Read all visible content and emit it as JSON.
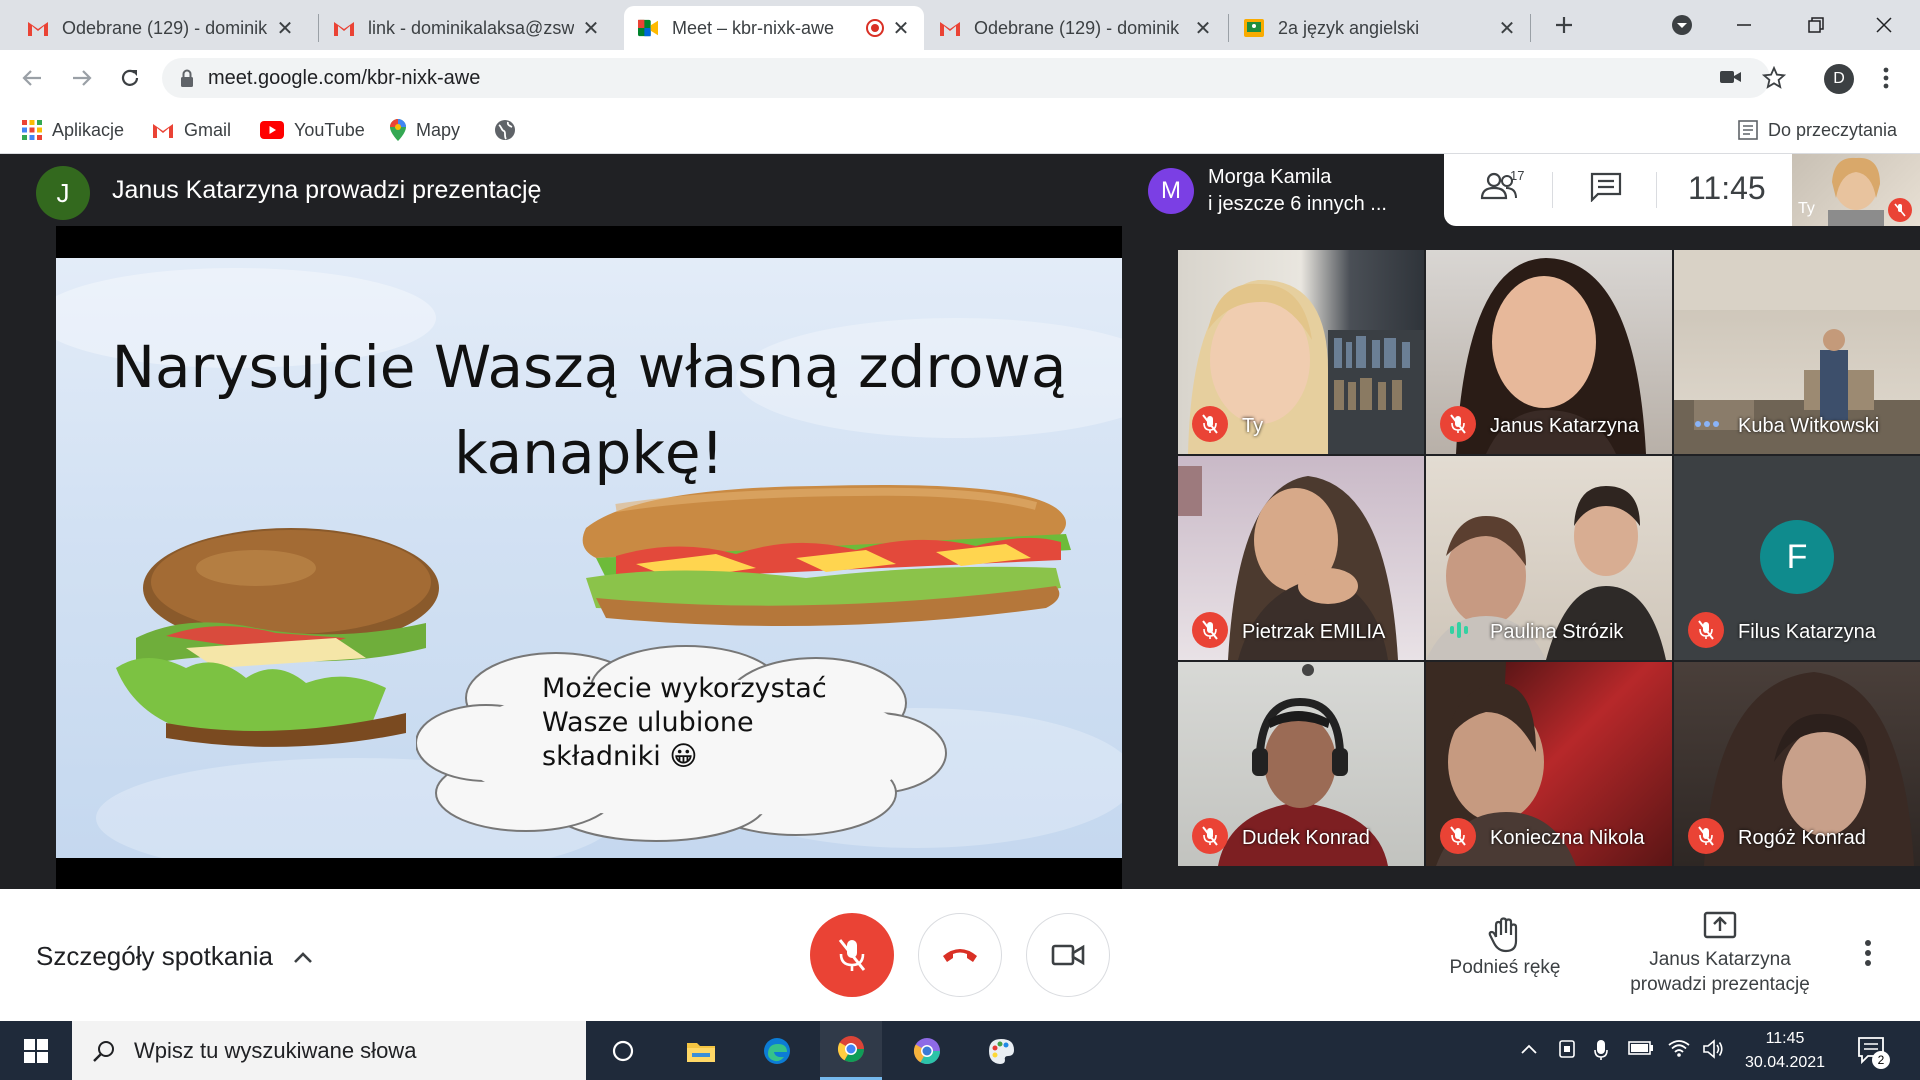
{
  "browser": {
    "tabs": [
      {
        "title": "Odebrane (129) - dominik",
        "icon": "gmail-icon"
      },
      {
        "title": "link - dominikalaksa@zsw",
        "icon": "gmail-icon"
      },
      {
        "title": "Meet – kbr-nixk-awe",
        "icon": "meet-icon",
        "active": true
      },
      {
        "title": "Odebrane (129) - dominik",
        "icon": "gmail-icon"
      },
      {
        "title": "2a język angielski",
        "icon": "classroom-icon"
      }
    ],
    "url": "meet.google.com/kbr-nixk-awe",
    "profile_initial": "D",
    "bookmarks": [
      {
        "label": "Aplikacje",
        "icon": "apps-grid-icon"
      },
      {
        "label": "Gmail",
        "icon": "gmail-icon"
      },
      {
        "label": "YouTube",
        "icon": "youtube-icon"
      },
      {
        "label": "Mapy",
        "icon": "maps-pin-icon"
      },
      {
        "label": "",
        "icon": "globe-icon"
      }
    ],
    "reading_list": "Do przeczytania"
  },
  "meet": {
    "presenter_initial": "J",
    "presenter_text": "Janus Katarzyna prowadzi prezentację",
    "slide": {
      "title_line1": "Narysujcie Waszą własną zdrową",
      "title_line2": "kanapkę!",
      "cloud_line1": "Możecie wykorzystać",
      "cloud_line2": "Wasze ulubione",
      "cloud_line3": "składniki 😀"
    },
    "pinned": {
      "initial": "M",
      "line1": "Morga Kamila",
      "line2": "i jeszcze 6 innych ..."
    },
    "people_count": "17",
    "clock": "11:45",
    "self_label": "Ty",
    "participants": [
      {
        "name": "Ty",
        "muted": true
      },
      {
        "name": "Janus Katarzyna",
        "muted": true
      },
      {
        "name": "Kuba Witkowski",
        "muted": false
      },
      {
        "name": "Pietrzak EMILIA",
        "muted": true
      },
      {
        "name": "Paulina Strózik",
        "muted": false
      },
      {
        "name": "Filus Katarzyna",
        "muted": true,
        "initial": "F"
      },
      {
        "name": "Dudek Konrad",
        "muted": true
      },
      {
        "name": "Konieczna Nikola",
        "muted": true
      },
      {
        "name": "Rogóż Konrad",
        "muted": true
      }
    ],
    "controls": {
      "details": "Szczegóły spotkania",
      "raise_hand": "Podnieś rękę",
      "presenting_line1": "Janus Katarzyna",
      "presenting_line2": "prowadzi prezentację"
    }
  },
  "taskbar": {
    "search_placeholder": "Wpisz tu wyszukiwane słowa",
    "time": "11:45",
    "date": "30.04.2021",
    "notifications": "2"
  },
  "colors": {
    "meet_bg": "#202124",
    "mute_red": "#ea4335",
    "accent_blue": "#1a73e8"
  }
}
